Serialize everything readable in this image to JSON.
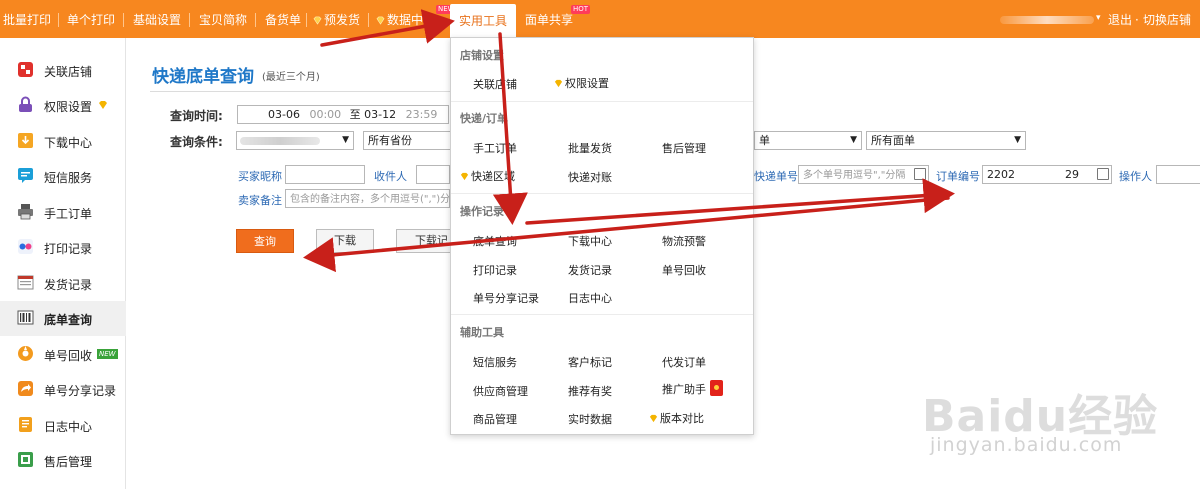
{
  "topnav": {
    "items": [
      {
        "label": "批量打印"
      },
      {
        "label": "单个打印"
      },
      {
        "label": "基础设置"
      },
      {
        "label": "宝贝简称"
      },
      {
        "label": "备货单"
      },
      {
        "label": "预发货",
        "icon": "diamond-icon"
      },
      {
        "label": "数据中心",
        "icon": "diamond-icon",
        "badge": "NEW"
      },
      {
        "label": "实用工具",
        "active": true
      },
      {
        "label": "面单共享",
        "badge": "HOT"
      }
    ],
    "logout": "退出",
    "switch_shop": "切换店铺"
  },
  "sidebar": {
    "items": [
      {
        "label": "关联店铺",
        "icon": "link-shop-icon"
      },
      {
        "label": "权限设置",
        "icon": "lock-icon"
      },
      {
        "label": "下载中心",
        "icon": "download-icon"
      },
      {
        "label": "短信服务",
        "icon": "sms-icon"
      },
      {
        "label": "手工订单",
        "icon": "manual-order-icon"
      },
      {
        "label": "打印记录",
        "icon": "print-record-icon"
      },
      {
        "label": "发货记录",
        "icon": "shipping-record-icon"
      },
      {
        "label": "底单查询",
        "icon": "barcode-icon",
        "active": true
      },
      {
        "label": "单号回收",
        "icon": "recycle-icon",
        "badge": "NEW"
      },
      {
        "label": "单号分享记录",
        "icon": "share-icon"
      },
      {
        "label": "日志中心",
        "icon": "log-icon"
      },
      {
        "label": "售后管理",
        "icon": "after-sale-icon"
      }
    ]
  },
  "main": {
    "title": "快递底单查询",
    "subtitle": "(最近三个月)",
    "query_time_label": "查询时间:",
    "date_from": "03-06",
    "time_from": "00:00",
    "range_sep": "至",
    "date_to": "03-12",
    "time_to": "23:59",
    "condition_label": "查询条件:",
    "province_select": "所有省份",
    "order_select_tail": "单",
    "waybill_select": "所有面单",
    "buyer_nick_label": "买家昵称",
    "receiver_label": "收件人",
    "express_no_label": "快递单号",
    "express_no_placeholder": "多个单号用逗号\",\"分隔",
    "order_no_label": "订单编号",
    "order_no_value": "2202",
    "order_no_tail": "29",
    "operator_label": "操作人",
    "seller_note_label": "卖家备注",
    "seller_note_placeholder": "包含的备注内容，多个用逗号(\",\")分",
    "btn_query": "查询",
    "btn_download": "下载",
    "btn_download2": "下载记"
  },
  "dropdown": {
    "sections": [
      {
        "title": "店铺设置",
        "items": [
          "关联店铺",
          "权限设置"
        ]
      },
      {
        "title": "快递/订单",
        "items": [
          "手工订单",
          "批量发货",
          "售后管理",
          "快递区域",
          "快递对账"
        ]
      },
      {
        "title": "操作记录",
        "items": [
          "底单查询",
          "下载中心",
          "物流预警",
          "打印记录",
          "发货记录",
          "单号回收",
          "单号分享记录",
          "日志中心"
        ]
      },
      {
        "title": "辅助工具",
        "items": [
          "短信服务",
          "客户标记",
          "代发订单",
          "供应商管理",
          "推荐有奖",
          "推广助手",
          "商品管理",
          "实时数据",
          "版本对比"
        ]
      }
    ]
  },
  "watermark": {
    "line1": "Baidu经验",
    "line2": "jingyan.baidu.com"
  },
  "colors": {
    "nav_orange": "#f7871f",
    "title_blue": "#1f78c8",
    "arrow_red": "#c8201a",
    "query_button": "#f06d1d"
  }
}
